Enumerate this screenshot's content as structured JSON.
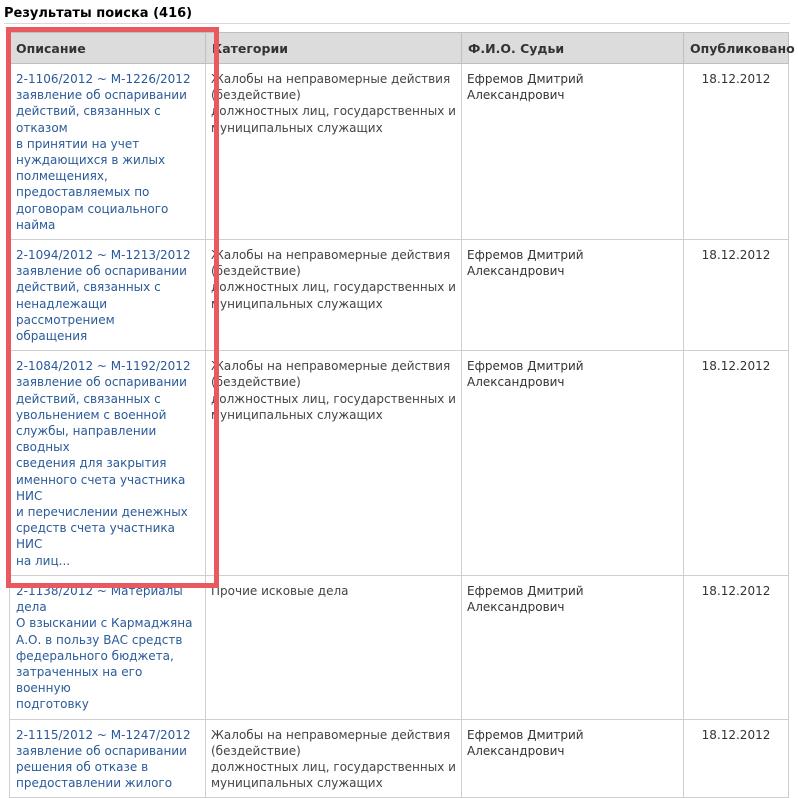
{
  "results_header": "Результаты поиска (416)",
  "columns": {
    "description": "Описание",
    "categories": "Категории",
    "judge": "Ф.И.О. Судьи",
    "published": "Опубликовано"
  },
  "rows": [
    {
      "description_lines": [
        "2-1106/2012 ~ М-1226/2012",
        "заявление об оспаривании",
        "действий, связанных с отказом",
        "в принятии на учет",
        "нуждающихся в жилых",
        "полмещениях,",
        "предоставляемых по",
        "договорам социального найма"
      ],
      "category_lines": [
        "Жалобы на неправомерные действия",
        "(бездействие)",
        "должностных лиц, государственных и",
        "муниципальных служащих"
      ],
      "judge": "Ефремов Дмитрий Александрович",
      "date": "18.12.2012"
    },
    {
      "description_lines": [
        "2-1094/2012 ~ М-1213/2012",
        "заявление об оспаривании",
        "действий, связанных с",
        "ненадлежащи рассмотрением",
        "обращения"
      ],
      "category_lines": [
        "Жалобы на неправомерные действия",
        "(бездействие)",
        "должностных лиц, государственных и",
        "муниципальных служащих"
      ],
      "judge": "Ефремов Дмитрий Александрович",
      "date": "18.12.2012"
    },
    {
      "description_lines": [
        "2-1084/2012 ~ М-1192/2012",
        "заявление об оспаривании",
        "действий, связанных с",
        "увольнением с военной",
        "службы, направлении сводных",
        "сведения для закрытия",
        "именного счета участника НИС",
        "и перечислении денежных",
        "средств счета участника НИС",
        "на лиц..."
      ],
      "category_lines": [
        "Жалобы на неправомерные действия",
        "(бездействие)",
        "должностных лиц, государственных и",
        "муниципальных служащих"
      ],
      "judge": "Ефремов Дмитрий Александрович",
      "date": "18.12.2012"
    },
    {
      "description_lines": [
        "2-1138/2012 ~ Материалы дела",
        "О взыскании с Кармаджяна",
        "А.О. в пользу ВАС средств",
        "федерального бюджета,",
        "затраченных на его военную",
        "подготовку"
      ],
      "category_lines": [
        "Прочие исковые дела"
      ],
      "judge": "Ефремов Дмитрий Александрович",
      "date": "18.12.2012"
    },
    {
      "description_lines": [
        "2-1115/2012 ~ М-1247/2012",
        "заявление об оспаривании",
        "решения об отказе в",
        "предоставлении жилого"
      ],
      "category_lines": [
        "Жалобы на неправомерные действия",
        "(бездействие)",
        "должностных лиц, государственных и",
        "муниципальных служащих"
      ],
      "judge": "Ефремов Дмитрий Александрович",
      "date": "18.12.2012"
    }
  ],
  "colors": {
    "link": "#2a5a9a",
    "header_bg": "#dcdcdc",
    "highlight": "#e85a5f"
  }
}
